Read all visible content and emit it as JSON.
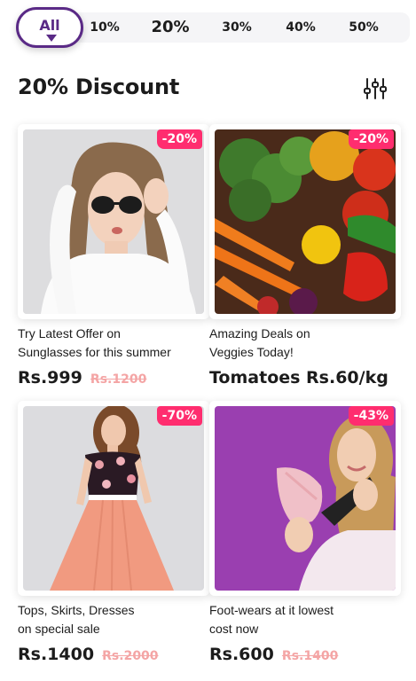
{
  "tabs": {
    "active": "All",
    "items": [
      "10%",
      "20%",
      "30%",
      "40%",
      "50%"
    ]
  },
  "section": {
    "title": "20% Discount"
  },
  "products": [
    {
      "badge": "-20%",
      "description_line1": "Try Latest Offer on",
      "description_line2": "Sunglasses for this summer",
      "price": "Rs.999",
      "old_price": "Rs.1200"
    },
    {
      "badge": "-20%",
      "description_line1": "Amazing Deals on",
      "description_line2": "Veggies Today!",
      "price": "Tomatoes Rs.60/kg",
      "old_price": ""
    },
    {
      "badge": "-70%",
      "description_line1": "Tops, Skirts, Dresses",
      "description_line2": "on special sale",
      "price": "Rs.1400",
      "old_price": "Rs.2000"
    },
    {
      "badge": "-43%",
      "description_line1": "Foot-wears at it lowest",
      "description_line2": "cost now",
      "price": "Rs.600",
      "old_price": "Rs.1400"
    }
  ],
  "colors": {
    "accent": "#5a2a86",
    "badge": "#ff2d6f",
    "old_price": "#f4a5a5"
  },
  "icons": {
    "filter": "sliders-icon"
  }
}
